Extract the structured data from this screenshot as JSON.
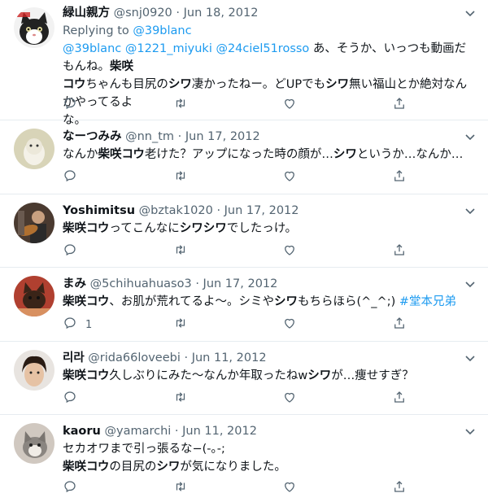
{
  "tweets": [
    {
      "name": "緑山親方",
      "handle": "@snj0920",
      "date": "Jun 18, 2012",
      "replying_prefix": "Replying to ",
      "replying_handle": "@39blanc",
      "segments": [
        {
          "t": "@39blanc @1221_miyuki @24ciel51rosso",
          "s": "link"
        },
        {
          "t": " あ、そうか、いっつも動画だもんね。",
          "s": ""
        },
        {
          "t": "柴咲",
          "s": "b"
        },
        {
          "t": "\n",
          "s": ""
        },
        {
          "t": "コウ",
          "s": "b"
        },
        {
          "t": "ちゃんも目尻の",
          "s": ""
        },
        {
          "t": "シワ",
          "s": "b"
        },
        {
          "t": "凄かったねー。どUPでも",
          "s": ""
        },
        {
          "t": "シワ",
          "s": "b"
        },
        {
          "t": "無い福山とか絶対なんかやってるよ\nな。",
          "s": ""
        }
      ],
      "reply_count": ""
    },
    {
      "name": "なーつみみ",
      "handle": "@nn_tm",
      "date": "Jun 17, 2012",
      "segments": [
        {
          "t": "なんか",
          "s": ""
        },
        {
          "t": "柴咲コウ",
          "s": "b"
        },
        {
          "t": "老けた？アップになった時の顔が…",
          "s": ""
        },
        {
          "t": "シワ",
          "s": "b"
        },
        {
          "t": "というか…なんか…",
          "s": ""
        }
      ],
      "reply_count": ""
    },
    {
      "name": "Yoshimitsu",
      "handle": "@bztak1020",
      "date": "Jun 17, 2012",
      "segments": [
        {
          "t": "柴咲コウ",
          "s": "b"
        },
        {
          "t": "ってこんなに",
          "s": ""
        },
        {
          "t": "シワシワ",
          "s": "b"
        },
        {
          "t": "でしたっけ。",
          "s": ""
        }
      ],
      "reply_count": ""
    },
    {
      "name": "まみ",
      "handle": "@5chihuahuaso3",
      "date": "Jun 17, 2012",
      "segments": [
        {
          "t": "柴咲コウ",
          "s": "b"
        },
        {
          "t": "、お肌が荒れてるよ〜。シミや",
          "s": ""
        },
        {
          "t": "シワ",
          "s": "b"
        },
        {
          "t": "もちらほら(^_^;) ",
          "s": ""
        },
        {
          "t": "#堂本兄弟",
          "s": "link"
        }
      ],
      "reply_count": "1"
    },
    {
      "name": "리라",
      "handle": "@rida66loveebi",
      "date": "Jun 11, 2012",
      "segments": [
        {
          "t": "柴咲コウ",
          "s": "b"
        },
        {
          "t": "久しぶりにみた〜なんか年取ったねw",
          "s": ""
        },
        {
          "t": "シワ",
          "s": "b"
        },
        {
          "t": "が…痩せすぎ？",
          "s": ""
        }
      ],
      "reply_count": ""
    },
    {
      "name": "kaoru",
      "handle": "@yamarchi",
      "date": "Jun 11, 2012",
      "segments": [
        {
          "t": "セカオワまで引っ張るな−(-｡-;\n",
          "s": ""
        },
        {
          "t": "柴咲コウ",
          "s": "b"
        },
        {
          "t": "の目尻の",
          "s": ""
        },
        {
          "t": "シワ",
          "s": "b"
        },
        {
          "t": "が気になりました。",
          "s": ""
        }
      ],
      "reply_count": ""
    }
  ],
  "dot": "·",
  "icons": {
    "caret": "chevron-down-icon",
    "reply": "reply-icon",
    "retweet": "retweet-icon",
    "like": "heart-icon",
    "share": "share-icon"
  },
  "colors": {
    "link": "#1d9bf0",
    "secondary_text": "#536471",
    "divider": "#e6ecf0"
  }
}
